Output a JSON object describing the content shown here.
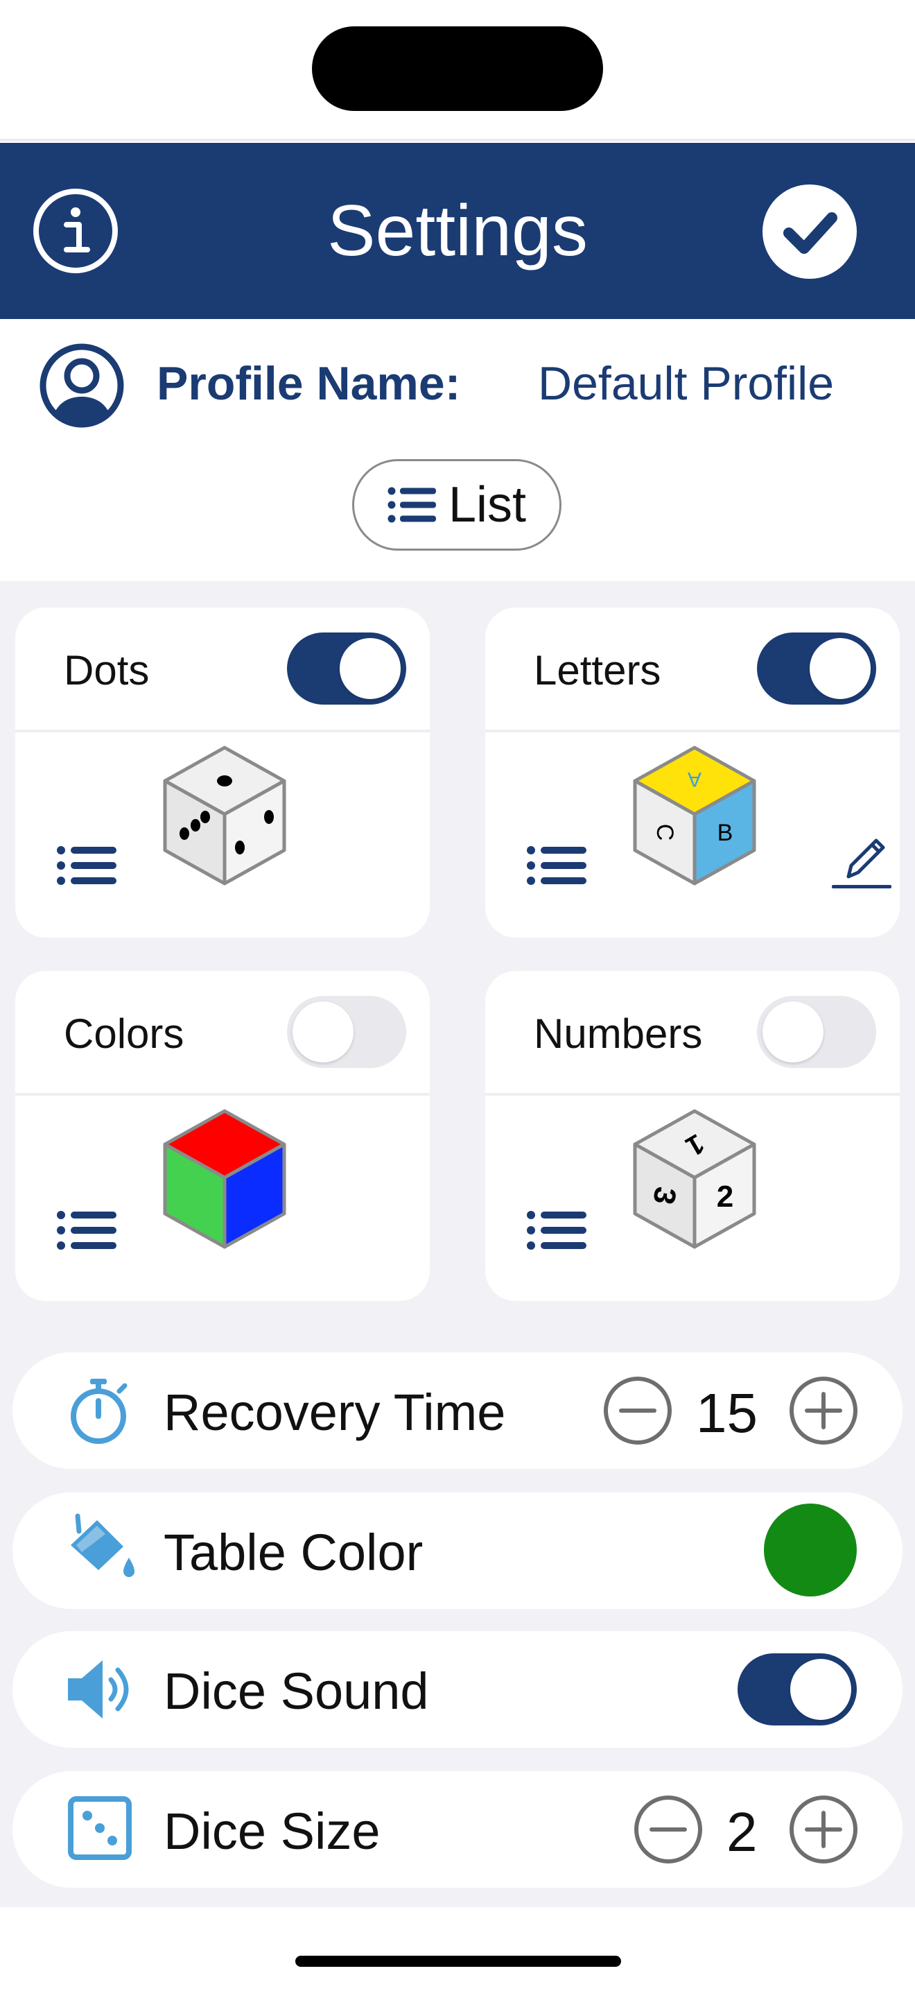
{
  "header": {
    "title": "Settings",
    "info_icon": "info-icon",
    "done_icon": "checkmark-icon"
  },
  "profile": {
    "label": "Profile Name:",
    "value": "Default Profile",
    "icon": "person-circle-icon"
  },
  "list_button": {
    "label": "List",
    "icon": "list-icon"
  },
  "dice_types": [
    {
      "label": "Dots",
      "enabled": true,
      "icon": "dots-die-icon",
      "editable": false
    },
    {
      "label": "Letters",
      "enabled": true,
      "icon": "letters-die-icon",
      "editable": true,
      "die_letters": [
        "A",
        "C",
        "B"
      ]
    },
    {
      "label": "Colors",
      "enabled": false,
      "icon": "colors-die-icon",
      "editable": false
    },
    {
      "label": "Numbers",
      "enabled": false,
      "icon": "numbers-die-icon",
      "editable": false,
      "die_numbers": [
        "1",
        "3",
        "2"
      ]
    }
  ],
  "settings": {
    "recovery_time": {
      "label": "Recovery Time",
      "value": "15",
      "icon": "stopwatch-icon"
    },
    "table_color": {
      "label": "Table Color",
      "color": "#138a14",
      "icon": "paint-bucket-icon"
    },
    "dice_sound": {
      "label": "Dice Sound",
      "enabled": true,
      "icon": "speaker-icon"
    },
    "dice_size": {
      "label": "Dice Size",
      "value": "2",
      "icon": "die-face-icon"
    }
  },
  "colors": {
    "brand": "#1b3b73",
    "accent": "#4a9fd8",
    "table": "#138a14",
    "die_red": "#ff0000",
    "die_green": "#44d150",
    "die_blue": "#0a2cff",
    "die_yellow": "#ffe20a",
    "die_cyan": "#5ab4e4"
  }
}
